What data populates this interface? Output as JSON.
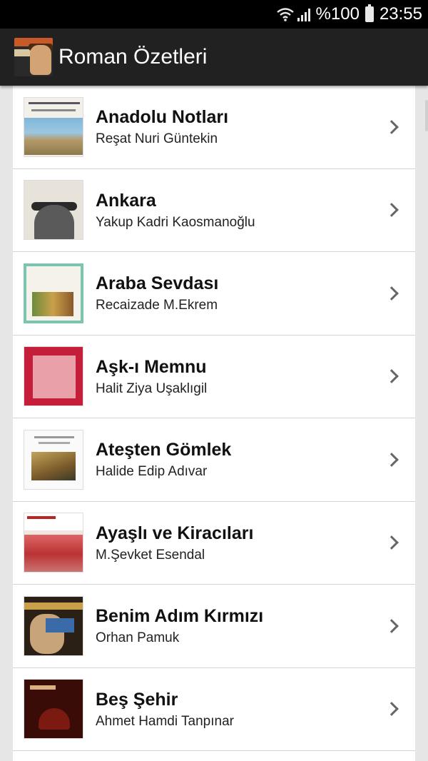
{
  "status_bar": {
    "battery": "%100",
    "time": "23:55"
  },
  "app_bar": {
    "title": "Roman Özetleri"
  },
  "items": [
    {
      "title": "Anadolu Notları",
      "author": "Reşat Nuri Güntekin"
    },
    {
      "title": "Ankara",
      "author": "Yakup Kadri Kaosmanoğlu"
    },
    {
      "title": "Araba Sevdası",
      "author": "Recaizade M.Ekrem"
    },
    {
      "title": "Aşk-ı Memnu",
      "author": "Halit Ziya Uşaklıgil"
    },
    {
      "title": "Ateşten Gömlek",
      "author": "Halide Edip Adıvar"
    },
    {
      "title": "Ayaşlı ve Kiracıları",
      "author": "M.Şevket Esendal"
    },
    {
      "title": "Benim Adım Kırmızı",
      "author": "Orhan Pamuk"
    },
    {
      "title": "Beş Şehir",
      "author": "Ahmet Hamdi Tanpınar"
    }
  ],
  "icons": {
    "status": [
      "wifi-icon",
      "signal-icon",
      "battery-icon"
    ],
    "row": "chevron-right-icon"
  },
  "colors": {
    "status_bar": "#000000",
    "app_bar": "#212121",
    "background": "#e6e6e6"
  }
}
